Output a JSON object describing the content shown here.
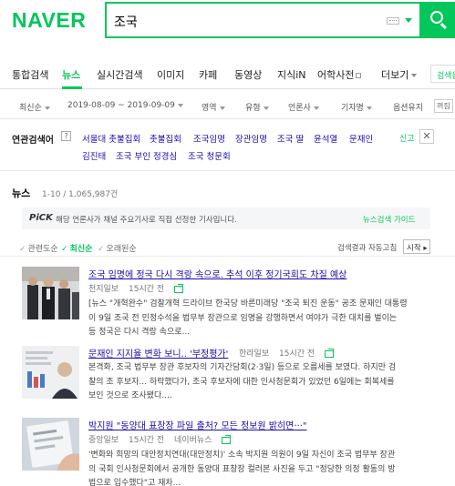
{
  "header": {
    "logo": "NAVER",
    "search_value": "조국"
  },
  "tabs": [
    "통합검색",
    "뉴스",
    "실시간검색",
    "이미지",
    "카페",
    "동영상",
    "지식iN",
    "어학사전",
    "더보기"
  ],
  "detail_search": "검색옵",
  "filters": [
    "최신순",
    "2019-08-09 ~ 2019-09-09",
    "영역",
    "유형",
    "언론사",
    "기자명",
    "옵션유지"
  ],
  "option_box": "꺼짐",
  "related": {
    "title": "연관검색어",
    "help": "?",
    "items": [
      "서울대 촛불집회",
      "촛불집회",
      "조국임명",
      "장관임명",
      "조국 딸",
      "윤석열",
      "문재인",
      "김진태",
      "조국 부인 정경심",
      "조국 청문회"
    ],
    "report": "신고",
    "close": "✕"
  },
  "news": {
    "label": "뉴스",
    "count": "1-10 / 1,065,987건"
  },
  "pick": {
    "logo": "PiCK",
    "text": "해당 언론사가 채널 주요기사로 직접 선정한 기사입니다.",
    "guide": "뉴스검색 가이드"
  },
  "sort": {
    "relevance": "관련도순",
    "latest": "최신순",
    "oldest": "오래된순",
    "auto": "검색결과 자동고침",
    "start": "시작"
  },
  "articles": [
    {
      "title": "조국 임명에 정국 다시 격랑 속으로. 추석 이후 정기국회도 차질 예상",
      "source": "천지일보",
      "time": "15시간 전",
      "lines": [
        "[뉴스 \"개혁완수\" 검찰개혁 드라이브 한국당 바른미래당 \"조국 퇴진 운동\" 공조 문재인 대통령",
        "이 9일 조국 전 민정수석을 법무부 장관으로 임명을 강행하면서 여야가 극한 대치를 벌이는",
        "등 정국은 다시 격랑 속으로..."
      ]
    },
    {
      "title": "문재인 지지율 변화 보니.. '부정평가'",
      "source": "한라일보",
      "time": "15시간 전",
      "lines": [
        "본격화, 조국 법무부 장관 후보자의 기자간담회(2·3일) 등으로 오름세를 보였다. 하지만 검",
        "찰의 조 후보자... 하락했다가, 조국 후보자에 대한 인사청문회가 있었던 6일에는 회복세를",
        "보인 것으로 조사됐다...."
      ]
    },
    {
      "title": "박지원 \"동양대 표창장 파일 출처? 모든 정보원 밝히면···\"",
      "source": "중앙일보",
      "time": "15시간 전",
      "portal": "네이버뉴스",
      "lines": [
        "'변화와 희망의 대안정치연대(대안정치)' 소속 박지원 의원이 9일 자신이 조국 법무부 장관",
        "의 국회 인사청문회에서 공개한 동양대 표창장 컬러본 사진을 두고 \"정당한 의정 활동의 방",
        "법으로 입수했다\"고 재차..."
      ]
    }
  ]
}
